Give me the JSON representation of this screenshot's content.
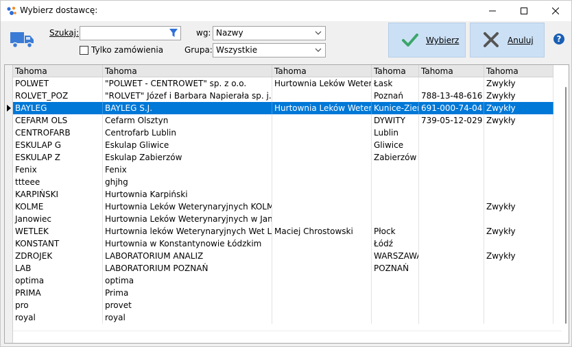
{
  "window": {
    "title": "Wybierz dostawcę:"
  },
  "toolbar": {
    "search_label": "Szukaj:",
    "search_value": "",
    "only_orders_label": "Tylko zamówienia",
    "only_orders_checked": false,
    "by_label": "wg:",
    "by_value": "Nazwy",
    "group_label": "Grupa:",
    "group_value": "Wszystkie",
    "select_label": "Wybierz",
    "cancel_label": "Anuluj",
    "help_label": "?"
  },
  "colors": {
    "accent": "#0078d7",
    "button_bg": "#cce0f5",
    "check_green": "#3aa66a",
    "cancel_gray": "#555555",
    "truck_blue": "#3a7bd5"
  },
  "grid": {
    "columns": [
      "Tahoma",
      "Tahoma",
      "Tahoma",
      "Tahoma",
      "Tahoma",
      "Tahoma"
    ],
    "selected_index": 2,
    "rows": [
      [
        "POLWET",
        "\"POLWET - CENTROWET\"  sp. z o.o.",
        "Hurtownia Leków Weterynaryjnych",
        "Łask",
        "",
        "Zwykły"
      ],
      [
        "ROLVET_POZ",
        "\"ROLVET\" Józef i Barbara Napierała sp. j.",
        "",
        "Poznań",
        "788-13-48-616",
        "Zwykły"
      ],
      [
        "BAYLEG",
        "BAYLEG S.J.",
        "Hurtownia Leków Weterynaryjnych",
        "Kunice-Ziemięcice",
        "691-000-74-04",
        "Zwykły"
      ],
      [
        "CEFARM OLS",
        "Cefarm Olsztyn",
        "",
        "DYWITY",
        "739-05-12-029",
        "Zwykły"
      ],
      [
        "CENTROFARB",
        "Centrofarb Lublin",
        "",
        "Lublin",
        "",
        ""
      ],
      [
        "ESKULAP G",
        "Eskulap Gliwice",
        "",
        "Gliwice",
        "",
        ""
      ],
      [
        "ESKULAP Z",
        "Eskulap Zabierzów",
        "",
        "Zabierzów",
        "",
        ""
      ],
      [
        "Fenix",
        "Fenix",
        "",
        "",
        "",
        ""
      ],
      [
        "ttteee",
        "ghjhg",
        "",
        "",
        "",
        ""
      ],
      [
        "KARPIŃSKI",
        "Hurtownia Karpiński",
        "",
        "",
        "",
        ""
      ],
      [
        "KOLME",
        "Hurtownia Leków Weterynaryjnych KOLME",
        "",
        "",
        "",
        "Zwykły"
      ],
      [
        "Janowiec",
        "Hurtownia Leków Weterynaryjnych w Janowcu",
        "",
        "",
        "",
        ""
      ],
      [
        "WETLEK",
        "Hurtownia leków Weterynaryjnych Wet Lek",
        "Maciej Chrostowski",
        "Płock",
        "",
        "Zwykły"
      ],
      [
        "KONSTANT",
        "Hurtownia w Konstantynowie Łódzkim",
        "",
        "Łódź",
        "",
        ""
      ],
      [
        "ZDROJEK",
        "LABORATORIUM  ANALIZ",
        "",
        "WARSZAWA",
        "",
        "Zwykły"
      ],
      [
        "LAB",
        "LABORATORIUM POZNAŃ",
        "",
        "POZNAŃ",
        "",
        ""
      ],
      [
        "optima",
        "optima",
        "",
        "",
        "",
        ""
      ],
      [
        "PRIMA",
        "Prima",
        "",
        "",
        "",
        ""
      ],
      [
        "pro",
        "provet",
        "",
        "",
        "",
        ""
      ],
      [
        "royal",
        "royal",
        "",
        "",
        "",
        ""
      ]
    ]
  }
}
